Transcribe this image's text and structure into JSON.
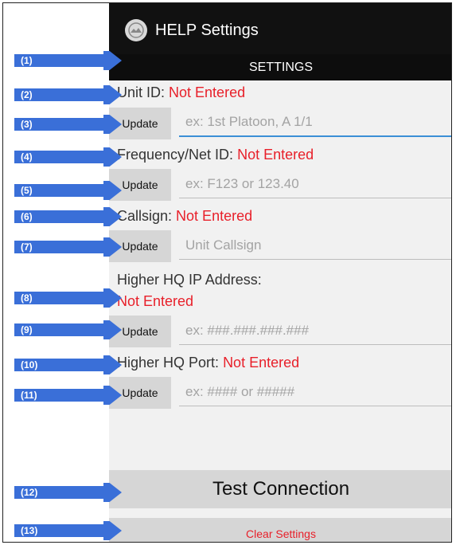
{
  "app": {
    "title": "HELP Settings",
    "icon": "app-logo-icon"
  },
  "section_header": "SETTINGS",
  "fields": [
    {
      "label": "Unit ID:",
      "value": "Not Entered",
      "button": "Update",
      "placeholder": "ex: 1st Platoon, A 1/1"
    },
    {
      "label": "Frequency/Net ID:",
      "value": "Not Entered",
      "button": "Update",
      "placeholder": "ex: F123 or 123.40"
    },
    {
      "label": "Callsign:",
      "value": "Not Entered",
      "button": "Update",
      "placeholder": "Unit Callsign"
    },
    {
      "label": "Higher HQ IP Address:",
      "value": "Not Entered",
      "button": "Update",
      "placeholder": "ex: ###.###.###.###"
    },
    {
      "label": "Higher HQ Port:",
      "value": "Not Entered",
      "button": "Update",
      "placeholder": "ex: #### or #####"
    }
  ],
  "buttons": {
    "test_connection": "Test Connection",
    "clear_settings": "Clear Settings"
  },
  "callouts": [
    "(1)",
    "(2)",
    "(3)",
    "(4)",
    "(5)",
    "(6)",
    "(7)",
    "(8)",
    "(9)",
    "(10)",
    "(11)",
    "(12)",
    "(13)"
  ],
  "colors": {
    "not_entered": "#e8202a",
    "callout_arrow": "#3a6fd8",
    "action_bar": "#111111",
    "focus_line": "#3b8fd6"
  }
}
